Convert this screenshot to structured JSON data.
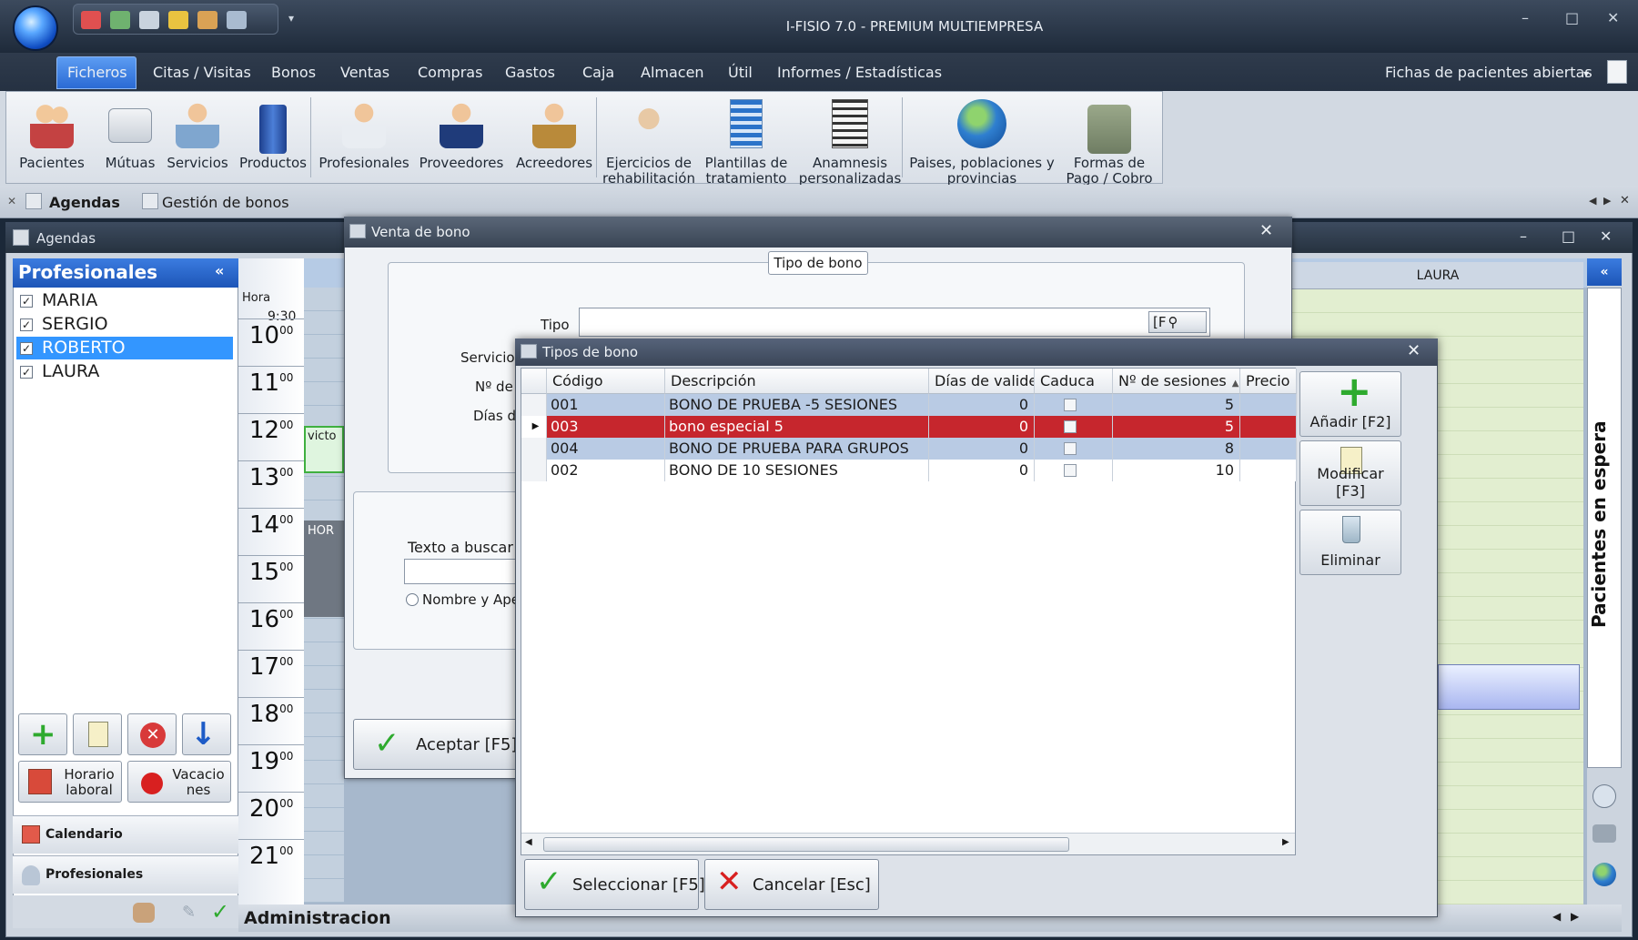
{
  "window": {
    "title": "I-FISIO 7.0 - PREMIUM MULTIEMPRESA"
  },
  "menu": {
    "items": [
      "Ficheros",
      "Citas / Visitas",
      "Bonos",
      "Ventas",
      "Compras",
      "Gastos",
      "Caja",
      "Almacen",
      "Útil",
      "Informes / Estadísticas"
    ],
    "right": "Fichas de pacientes abiertas"
  },
  "ribbon": {
    "buttons": [
      "Pacientes",
      "Mútuas",
      "Servicios",
      "Productos",
      "Profesionales",
      "Proveedores",
      "Acreedores",
      "Ejercicios de rehabilitación",
      "Plantillas de tratamiento",
      "Anamnesis personalizadas",
      "Paises, poblaciones y provincias",
      "Formas de Pago / Cobro"
    ]
  },
  "tabs": {
    "items": [
      "Agendas",
      "Gestión de bonos"
    ]
  },
  "agendas": {
    "title": "Agendas",
    "panel_title": "Profesionales",
    "professionals": [
      {
        "name": "MARIA",
        "checked": true
      },
      {
        "name": "SERGIO",
        "checked": true
      },
      {
        "name": "ROBERTO",
        "checked": true,
        "selected": true
      },
      {
        "name": "LAURA",
        "checked": true
      }
    ],
    "hora_label": "Hora",
    "first_time": "9:30",
    "hours": [
      "10",
      "11",
      "12",
      "13",
      "14",
      "15",
      "16",
      "17",
      "18",
      "19",
      "20",
      "21"
    ],
    "minutes": "00",
    "buttons": {
      "horario": "Horario laboral",
      "vacaciones": "Vacacio nes"
    },
    "nav": {
      "calendario": "Calendario",
      "profesionales": "Profesionales"
    },
    "appointment_text": "victo",
    "block_text": "HOR",
    "laura_col": "LAURA",
    "espera": "Pacientes en espera",
    "bottom_title": "Administracion"
  },
  "venta_bono": {
    "title": "Venta de bono",
    "group": "Tipo de bono",
    "tipo_label": "Tipo",
    "f_button": "[F",
    "servicio_label": "Servicio",
    "nde_label": "Nº de",
    "dias_label": "Días d",
    "buscar_label": "Texto a buscar",
    "radio_label": "Nombre y Ape",
    "aceptar": "Aceptar [F5]"
  },
  "tipos_bono": {
    "title": "Tipos de bono",
    "columns": [
      "Código",
      "Descripción",
      "Días de valide:",
      "Caduca",
      "Nº de sesiones",
      "Precio"
    ],
    "rows": [
      {
        "codigo": "001",
        "descripcion": "BONO DE PRUEBA -5 SESIONES",
        "dias": "0",
        "caduca": false,
        "sesiones": "5"
      },
      {
        "codigo": "003",
        "descripcion": "bono especial 5",
        "dias": "0",
        "caduca": false,
        "sesiones": "5"
      },
      {
        "codigo": "004",
        "descripcion": "BONO DE PRUEBA PARA GRUPOS",
        "dias": "0",
        "caduca": false,
        "sesiones": "8"
      },
      {
        "codigo": "002",
        "descripcion": "BONO DE 10 SESIONES",
        "dias": "0",
        "caduca": false,
        "sesiones": "10"
      }
    ],
    "buttons": {
      "anadir": "Añadir [F2]",
      "modificar": "Modificar [F3]",
      "eliminar": "Eliminar"
    },
    "seleccionar": "Seleccionar [F5]",
    "cancelar": "Cancelar [Esc]",
    "colors": {
      "selected_row": "#c6262d",
      "alt_row": "#b9cbe4"
    }
  }
}
